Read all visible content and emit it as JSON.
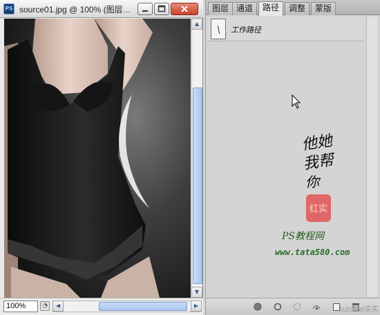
{
  "document_window": {
    "title": "source01.jpg @ 100% (图层…",
    "app_icon": "PS",
    "buttons": {
      "minimize": "minimize-icon",
      "maximize": "maximize-icon",
      "close": "close-icon"
    },
    "zoom_level": "100%"
  },
  "paths_panel": {
    "tabs": [
      {
        "label": "图层",
        "active": false
      },
      {
        "label": "通道",
        "active": false
      },
      {
        "label": "路径",
        "active": true
      },
      {
        "label": "调整",
        "active": false
      },
      {
        "label": "蒙版",
        "active": false
      }
    ],
    "paths": [
      {
        "name": "工作路径"
      }
    ],
    "footer_buttons": [
      "fill-path-icon",
      "stroke-path-icon",
      "load-as-selection-icon",
      "make-work-path-icon",
      "new-path-icon",
      "delete-path-icon"
    ]
  },
  "watermark": {
    "calligraphy": [
      "他她",
      "我帮",
      "你"
    ],
    "seal_text": "红实",
    "site_name": "PS教程网",
    "site_url": "www.tata580.com"
  },
  "corner_tag": "tutorial实实"
}
